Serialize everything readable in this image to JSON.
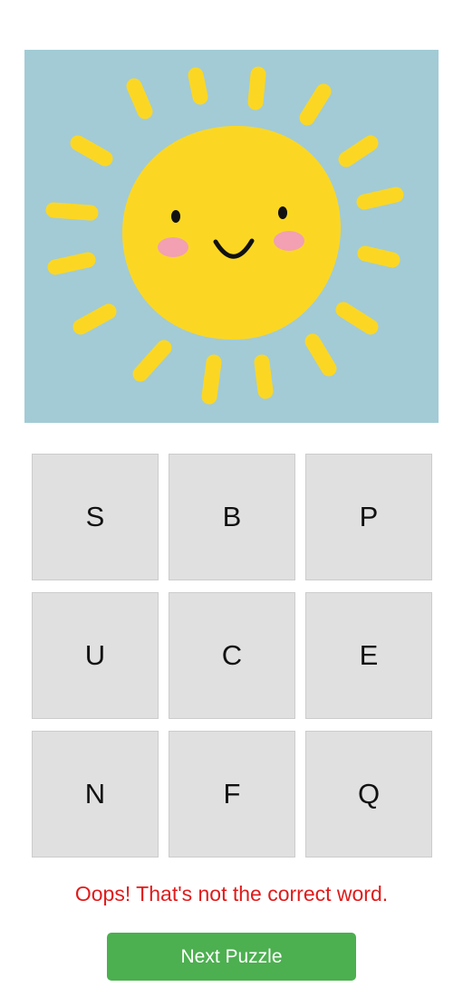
{
  "puzzle": {
    "image_subject": "smiling-sun",
    "colors": {
      "sky": "#a2cbd6",
      "sun": "#fbd724",
      "cheeks": "#f2a0b2",
      "face": "#111111"
    }
  },
  "letters": [
    "S",
    "B",
    "P",
    "U",
    "C",
    "E",
    "N",
    "F",
    "Q"
  ],
  "feedback": {
    "message": "Oops! That's not the correct word.",
    "color": "#e01b1b"
  },
  "actions": {
    "next_label": "Next Puzzle",
    "next_color": "#4caf50"
  }
}
